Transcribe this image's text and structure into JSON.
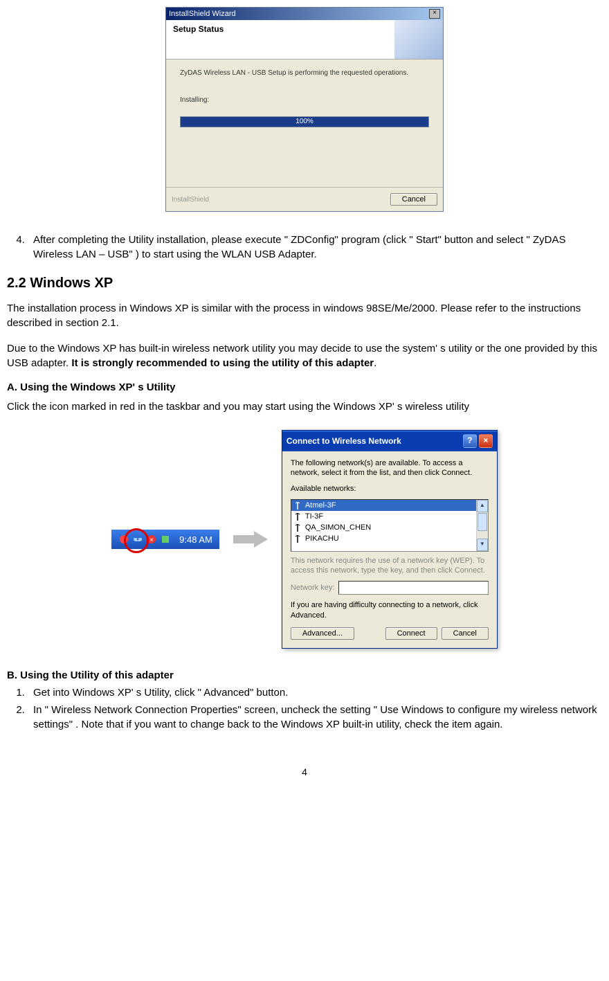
{
  "wizard": {
    "titlebar": "InstallShield Wizard",
    "header_title": "Setup Status",
    "message": "ZyDAS Wireless LAN - USB Setup is performing the requested operations.",
    "installing_label": "Installing:",
    "progress_text": "100%",
    "footer_left": "InstallShield",
    "cancel": "Cancel"
  },
  "step4": "After completing the Utility installation, please execute \" ZDConfig\" program (click \" Start\" button and select \" ZyDAS Wireless LAN – USB\" ) to start using the WLAN USB Adapter.",
  "section_title": "2.2    Windows XP",
  "para1": "The installation process in Windows XP is similar with the process in windows 98SE/Me/2000. Please refer to the instructions described in section 2.1.",
  "para2_pre": "Due to the Windows XP has built-in wireless network utility you may decide to use the system' s utility or the one provided by this USB adapter. ",
  "para2_bold": "It is strongly recommended to using the utility of this adapter",
  "para2_post": ".",
  "subA_title": "A. Using the Windows XP' s Utility",
  "subA_text": "Click the icon marked in red in the taskbar and you may start using the Windows XP' s wireless utility",
  "taskbar_time": "9:48 AM",
  "dialog": {
    "title": "Connect to Wireless Network",
    "intro": "The following network(s) are available. To access a network, select it from the list, and then click Connect.",
    "avail_label": "Available networks:",
    "networks": [
      "Atmel-3F",
      "TI-3F",
      "QA_SIMON_CHEN",
      "PIKACHU"
    ],
    "wep_note": "This network requires the use of a network key (WEP). To access this network, type the key, and then click Connect.",
    "key_label": "Network key:",
    "difficulty": "If you are having difficulty connecting to a network, click Advanced.",
    "btn_advanced": "Advanced...",
    "btn_connect": "Connect",
    "btn_cancel": "Cancel"
  },
  "subB_title": "B. Using the Utility of this adapter",
  "subB_item1": "Get into Windows XP' s Utility, click \" Advanced\"  button.",
  "subB_item2": "In \" Wireless Network Connection Properties\"  screen, uncheck the setting \" Use Windows to configure my wireless network settings\" . Note that if you want to change back to the Windows XP built-in utility, check the item again.",
  "page_number": "4"
}
